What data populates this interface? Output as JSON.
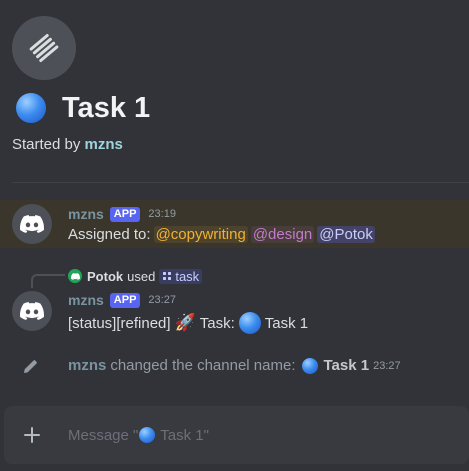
{
  "thread": {
    "title": "Task 1",
    "started_by_prefix": "Started by",
    "started_by_user": "mzns"
  },
  "messages": [
    {
      "author": "mzns",
      "badge": "APP",
      "time": "23:19",
      "text_prefix": "Assigned to:",
      "mentions": [
        "@copywriting",
        "@design",
        "@Potok"
      ]
    },
    {
      "reply_user": "Potok",
      "reply_used": "used",
      "reply_command": "task",
      "author": "mzns",
      "badge": "APP",
      "time": "23:27",
      "text_prefix": "[status][refined]",
      "rocket": "🚀",
      "text_task": "Task:",
      "text_task_name": "Task 1"
    }
  ],
  "system": {
    "author": "mzns",
    "text": "changed the channel name:",
    "channel": "Task 1",
    "time": "23:27"
  },
  "composer": {
    "placeholder_prefix": "Message \"",
    "placeholder_name": " Task 1\""
  },
  "colors": {
    "background": "#313338",
    "highlight": "#3b362c",
    "app_badge": "#5865f2",
    "role_copywriting": "#f0b232",
    "role_design": "#c27cc9"
  },
  "icons": {
    "thread_avatar": "thread-logo-icon",
    "bot_avatar": "discord-logo-icon",
    "system": "pencil-icon",
    "composer": "plus-icon"
  }
}
